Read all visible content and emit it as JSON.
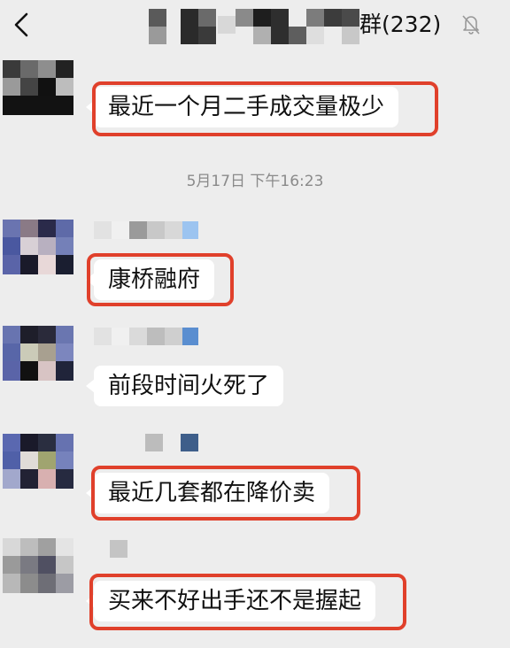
{
  "header": {
    "back_icon": "chevron-left-icon",
    "title_visible_text": "群(232)",
    "mute_icon": "bell-off-icon"
  },
  "timestamp": "5月17日 下午16:23",
  "messages": [
    {
      "text": "最近一个月二手成交量极少",
      "highlighted": true
    },
    {
      "text": "康桥融府",
      "highlighted": true
    },
    {
      "text": "前段时间火死了",
      "highlighted": false
    },
    {
      "text": "最近几套都在降价卖",
      "highlighted": true
    },
    {
      "text": "买来不好出手还不是握起",
      "highlighted": true
    }
  ],
  "colors": {
    "background": "#ededed",
    "bubble": "#ffffff",
    "highlight_border": "#e0402b"
  }
}
